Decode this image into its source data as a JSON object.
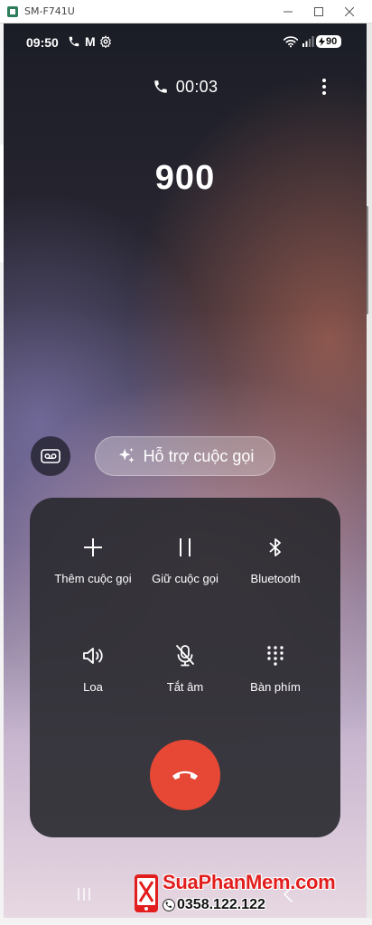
{
  "window": {
    "title": "SM-F741U"
  },
  "status_bar": {
    "time": "09:50",
    "notification_letter": "M",
    "battery": "90",
    "icons": [
      "phone-icon",
      "gmail-icon",
      "settings-icon",
      "wifi-icon",
      "signal-icon",
      "battery-charging-icon"
    ]
  },
  "call": {
    "timer": "00:03",
    "number": "900"
  },
  "assist": {
    "label": "Hỗ trợ cuộc gọi"
  },
  "controls": {
    "add_call": "Thêm cuộc gọi",
    "hold_call": "Giữ cuộc gọi",
    "bluetooth": "Bluetooth",
    "speaker": "Loa",
    "mute": "Tắt âm",
    "keypad": "Bàn phím"
  },
  "watermark": {
    "brand": "SuaPhanMem.com",
    "phone": "0358.122.122"
  },
  "colors": {
    "end_call": "#e64835",
    "watermark_red": "#e21d1d",
    "panel": "#28282e"
  }
}
